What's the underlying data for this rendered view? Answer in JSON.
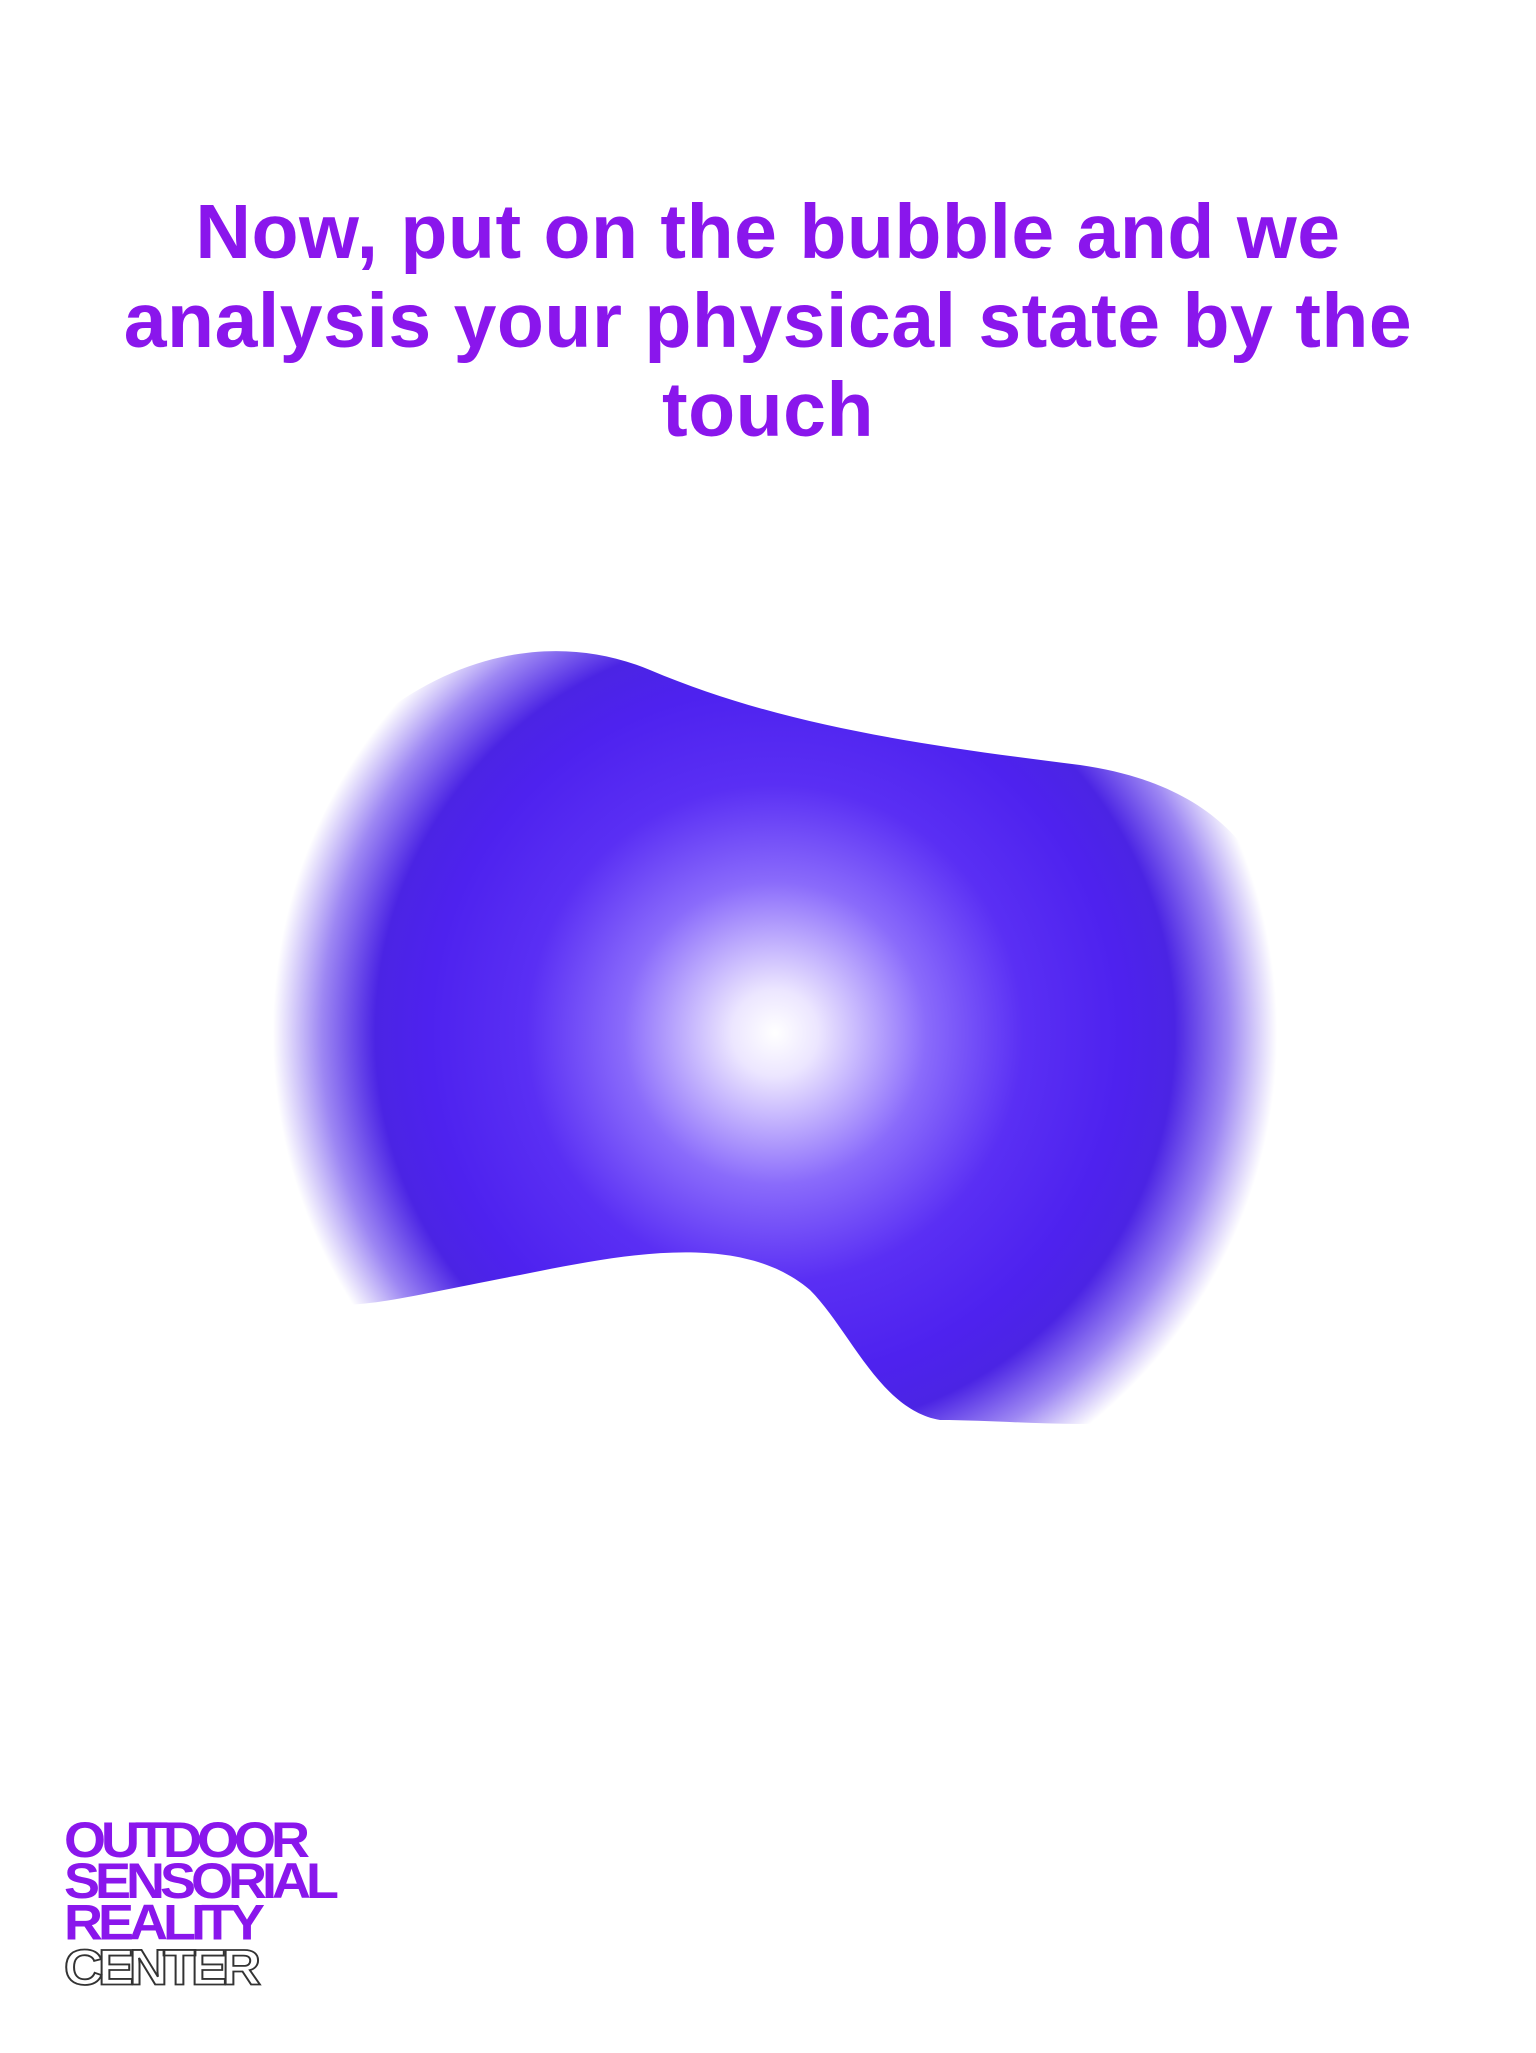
{
  "headline": "Now, put on the bubble and we analysis your physical state by the touch",
  "logo": {
    "line1": "OUTDOOR",
    "line2": "SENSORIAL",
    "line3": "REALITY",
    "line4": "CENTER"
  },
  "colors": {
    "accent": "#8a16ec",
    "bubble_core": "#ffffff",
    "bubble_mid": "#5b2ff5",
    "bubble_edge": "#4b22e8",
    "background": "#ffffff"
  }
}
